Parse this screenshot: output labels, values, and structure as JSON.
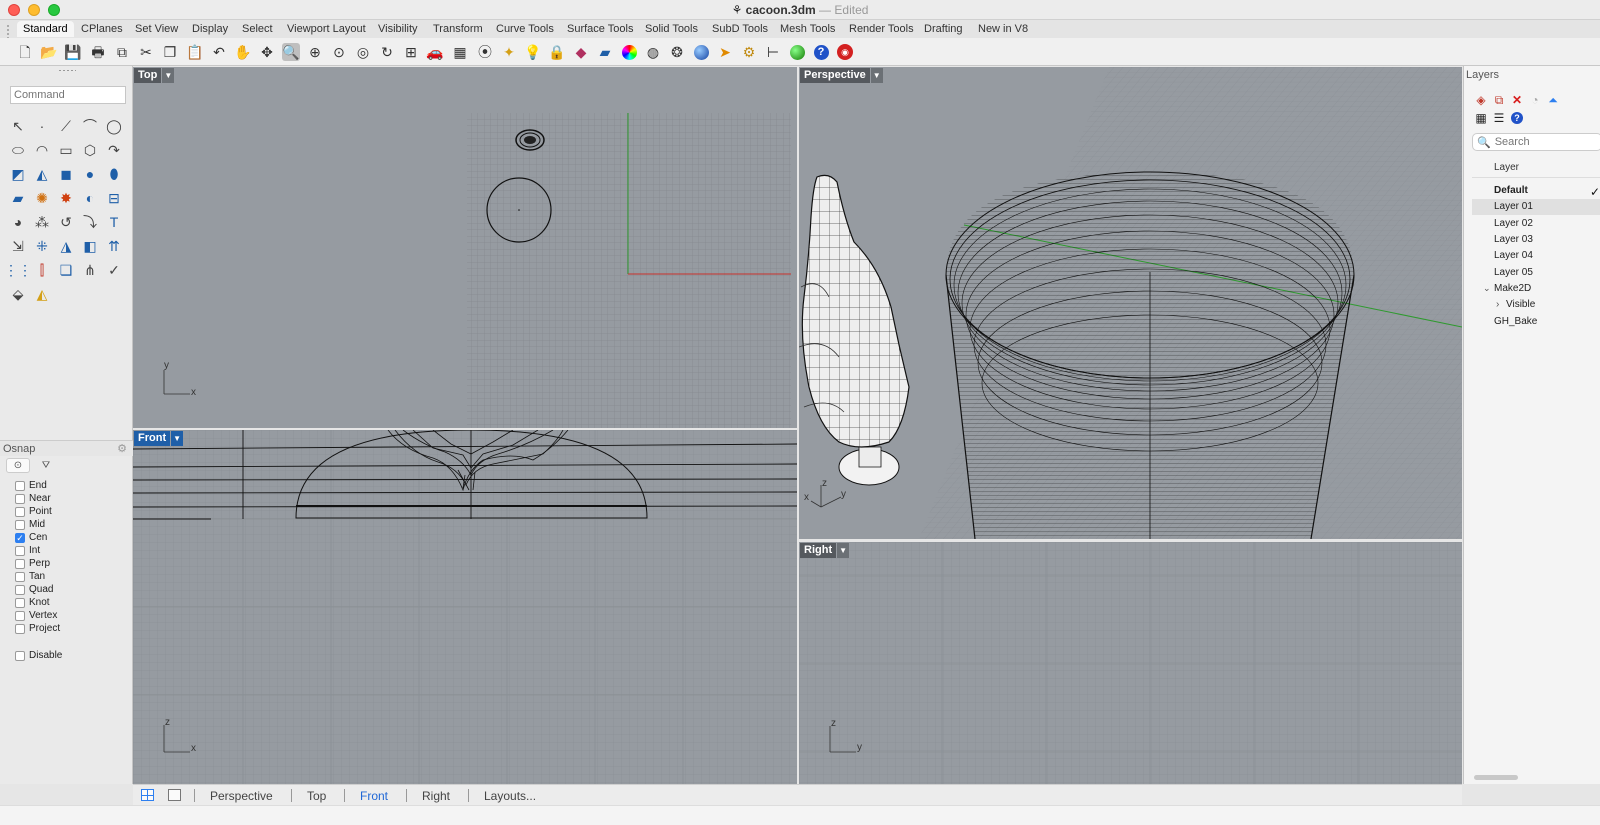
{
  "window": {
    "file_name": "cacoon.3dm",
    "separator": "—",
    "status": "Edited"
  },
  "tabs": [
    {
      "label": "Standard",
      "active": true
    },
    {
      "label": "CPlanes"
    },
    {
      "label": "Set View"
    },
    {
      "label": "Display"
    },
    {
      "label": "Select"
    },
    {
      "label": "Viewport Layout"
    },
    {
      "label": "Visibility"
    },
    {
      "label": "Transform"
    },
    {
      "label": "Curve Tools"
    },
    {
      "label": "Surface Tools"
    },
    {
      "label": "Solid Tools"
    },
    {
      "label": "SubD Tools"
    },
    {
      "label": "Mesh Tools"
    },
    {
      "label": "Render Tools"
    },
    {
      "label": "Drafting"
    },
    {
      "label": "New in V8"
    }
  ],
  "toolbar_icons": [
    "new-document-icon",
    "open-folder-icon",
    "save-icon",
    "print-icon",
    "import-icon",
    "cut-icon",
    "copy-icon",
    "paste-icon",
    "undo-icon",
    "pan-hand-icon",
    "rotate-view-icon",
    "zoom-window-icon",
    "zoom-extents-icon",
    "zoom-selected-icon",
    "zoom-target-icon",
    "rotate-camera-icon",
    "four-viewports-icon",
    "car-render-icon",
    "grid-plane-icon",
    "snap-target-icon",
    "light-icon",
    "lightbulb-icon",
    "lock-icon",
    "shading-icon",
    "material-icon",
    "color-wheel-icon",
    "sphere-wire-icon",
    "render-sphere-icon",
    "blue-sphere-icon",
    "cursor-arrow-icon",
    "settings-gear-icon",
    "dimension-icon",
    "globe-icon",
    "help-icon",
    "rhino-logo-icon"
  ],
  "command": {
    "placeholder": "Command"
  },
  "osnap": {
    "title": "Osnap",
    "items": [
      {
        "label": "End",
        "checked": false
      },
      {
        "label": "Near",
        "checked": false
      },
      {
        "label": "Point",
        "checked": false
      },
      {
        "label": "Mid",
        "checked": false
      },
      {
        "label": "Cen",
        "checked": true
      },
      {
        "label": "Int",
        "checked": false
      },
      {
        "label": "Perp",
        "checked": false
      },
      {
        "label": "Tan",
        "checked": false
      },
      {
        "label": "Quad",
        "checked": false
      },
      {
        "label": "Knot",
        "checked": false
      },
      {
        "label": "Vertex",
        "checked": false
      },
      {
        "label": "Project",
        "checked": false
      }
    ],
    "disable": {
      "label": "Disable",
      "checked": false
    }
  },
  "viewports": {
    "top": {
      "name": "Top",
      "axis_h": "x",
      "axis_v": "y"
    },
    "front": {
      "name": "Front",
      "axis_h": "x",
      "axis_v": "z",
      "active": true
    },
    "perspective": {
      "name": "Perspective",
      "axis_h": "x",
      "axis_v": "y",
      "axis_z": "z"
    },
    "right": {
      "name": "Right",
      "axis_h": "y",
      "axis_v": "z"
    }
  },
  "layers": {
    "title": "Layers",
    "search_placeholder": "Search",
    "column_header": "Layer",
    "rows": [
      {
        "label": "Default",
        "bold": true,
        "current": true
      },
      {
        "label": "Layer 01",
        "selected": true
      },
      {
        "label": "Layer 02"
      },
      {
        "label": "Layer 03"
      },
      {
        "label": "Layer 04"
      },
      {
        "label": "Layer 05"
      },
      {
        "label": "Make2D",
        "expanded": true
      },
      {
        "label": "Visible",
        "indent": true
      },
      {
        "label": "GH_Bake"
      }
    ],
    "current_mark": "✓"
  },
  "statusbar": {
    "tabs": [
      {
        "label": "Perspective"
      },
      {
        "label": "Top"
      },
      {
        "label": "Front",
        "active": true
      },
      {
        "label": "Right"
      },
      {
        "label": "Layouts..."
      }
    ]
  },
  "colors": {
    "viewport_bg": "#969ba1",
    "active_label": "#1f5fa8",
    "x_axis": "#c8302c",
    "y_axis": "#2e9a2e"
  }
}
